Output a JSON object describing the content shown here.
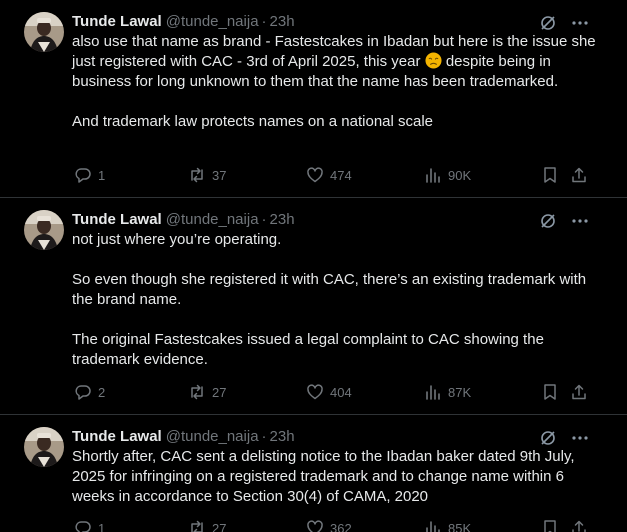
{
  "tweets": [
    {
      "author_name": "Tunde Lawal",
      "handle": "@tunde_naija",
      "separator": "·",
      "time": "23h",
      "paragraphs": [
        {
          "before_emoji": "also use that name as brand - Fastestcakes in Ibadan but here is the issue she just registered with CAC - 3rd of April 2025, this year ",
          "emoji": "disappointed-face-emoji",
          "after_emoji": " despite being in business for long unknown to them that the name has been trademarked."
        },
        {
          "text": "And trademark law protects names on a national scale"
        }
      ],
      "replies": "1",
      "reposts": "37",
      "likes": "474",
      "views": "90K"
    },
    {
      "author_name": "Tunde Lawal",
      "handle": "@tunde_naija",
      "separator": "·",
      "time": "23h",
      "paragraphs": [
        {
          "text": "not just where you’re operating."
        },
        {
          "text": "So even though she registered it with CAC, there’s an existing trademark with the brand name."
        },
        {
          "text": "The original Fastestcakes issued a legal complaint to CAC showing the trademark evidence."
        }
      ],
      "replies": "2",
      "reposts": "27",
      "likes": "404",
      "views": "87K"
    },
    {
      "author_name": "Tunde Lawal",
      "handle": "@tunde_naija",
      "separator": "·",
      "time": "23h",
      "paragraphs": [
        {
          "text": "Shortly after, CAC sent a delisting notice to the Ibadan baker dated 9th July, 2025 for infringing on a registered trademark and to change name within 6 weeks in accordance to Section 30(4) of CAMA, 2020"
        }
      ],
      "replies": "1",
      "reposts": "27",
      "likes": "362",
      "views": "85K"
    }
  ],
  "icons": {
    "grok": "grok-icon",
    "more": "more-options-icon",
    "reply": "reply-icon",
    "repost": "repost-icon",
    "like": "like-icon",
    "views": "views-icon",
    "bookmark": "bookmark-icon",
    "share": "share-icon"
  },
  "colors": {
    "background": "#000000",
    "text": "#e7e9ea",
    "secondary": "#71767b",
    "divider": "#2f3336"
  }
}
